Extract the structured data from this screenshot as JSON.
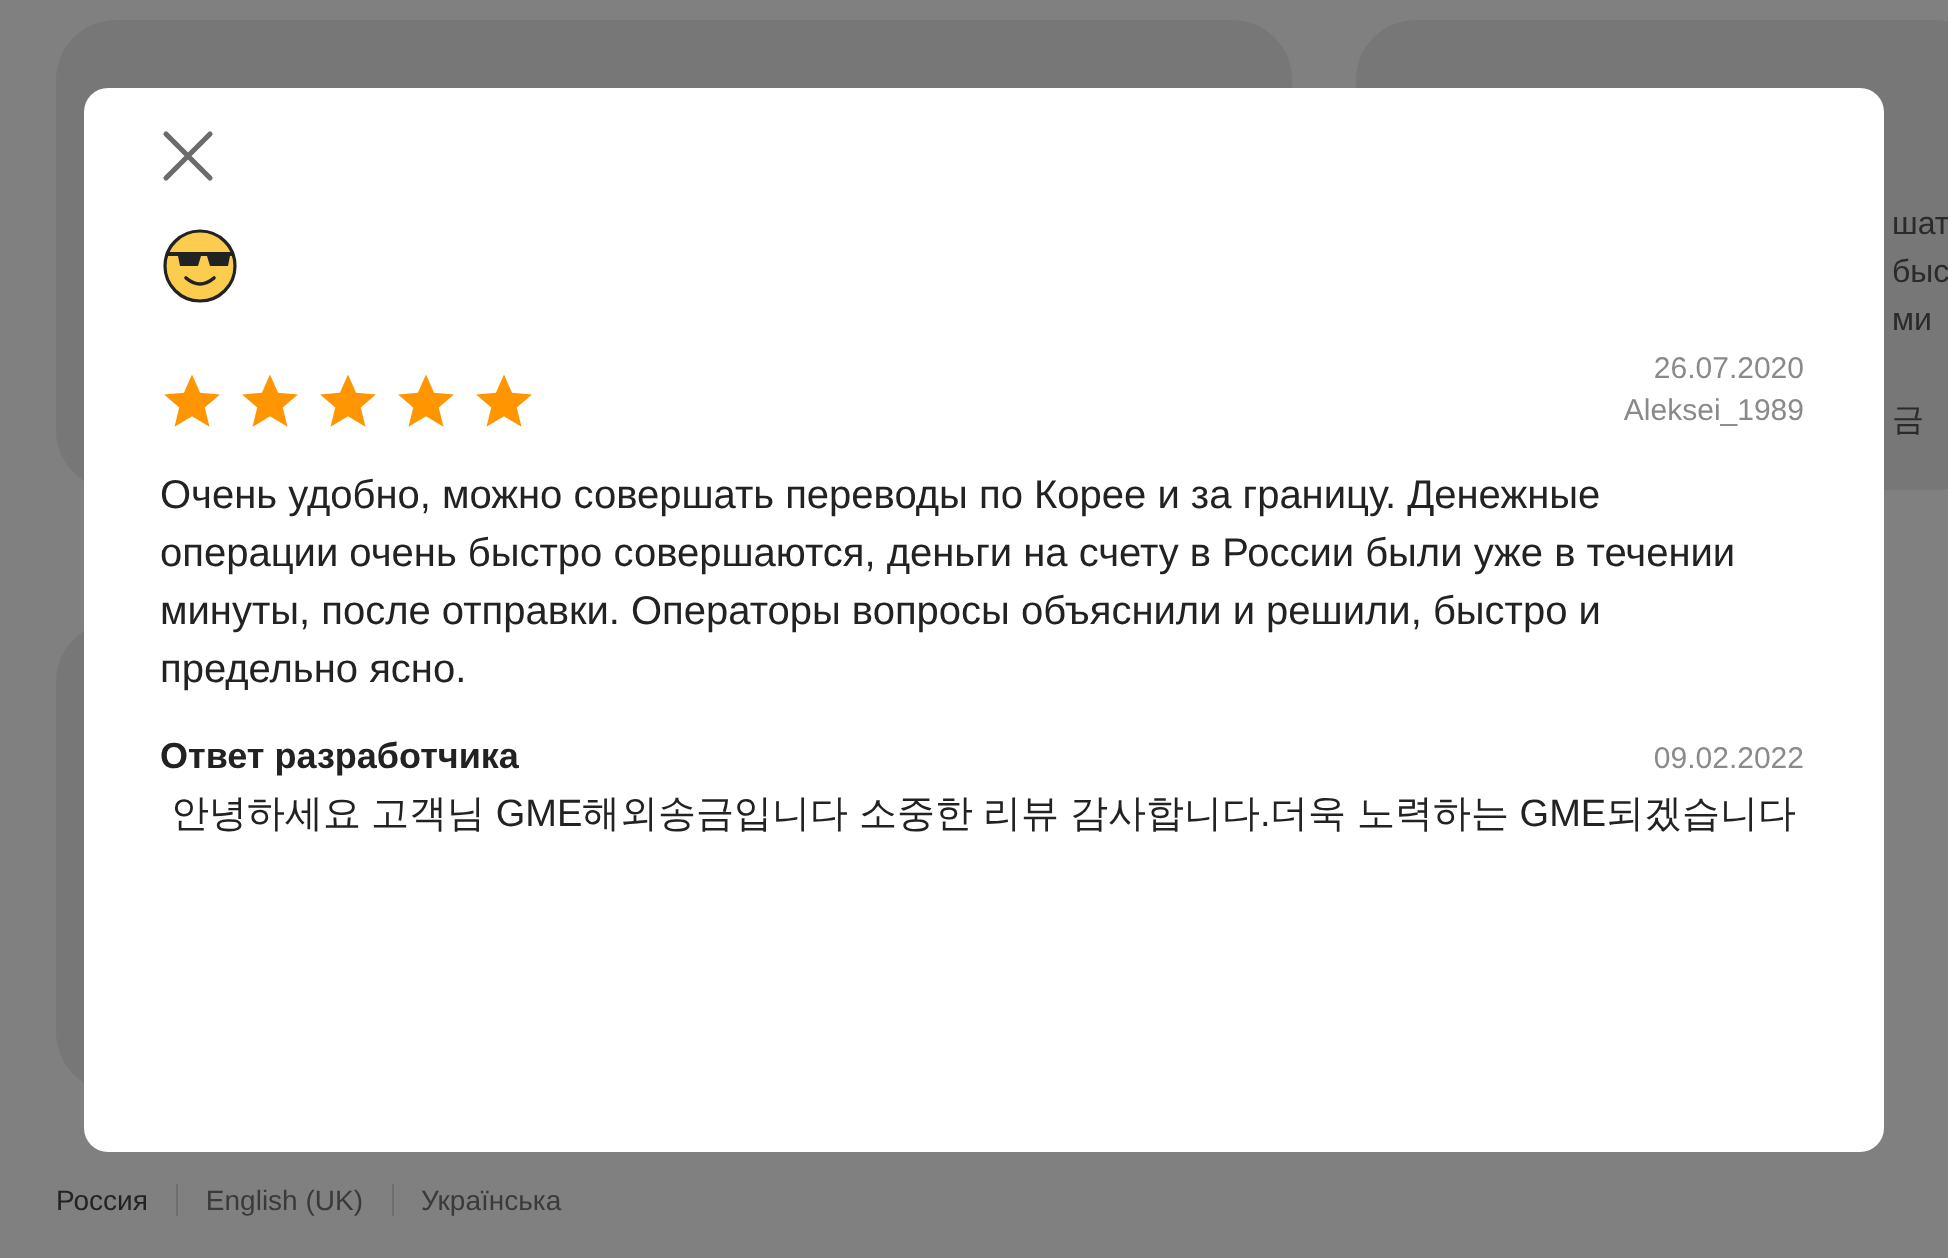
{
  "right_card": {
    "fragments": [
      "шат",
      "быс",
      "ми",
      "금"
    ]
  },
  "footer": {
    "languages": [
      {
        "label": "Россия",
        "selected": true
      },
      {
        "label": "English (UK)",
        "selected": false
      },
      {
        "label": "Українська",
        "selected": false
      }
    ]
  },
  "review_dialog": {
    "stars": 5,
    "date": "26.07.2020",
    "author": "Aleksei_1989",
    "text": "Очень удобно, можно совершать переводы по Корее и за границу. Денежные операции очень быстро совершаются,  деньги на счету в России были уже в течении минуты, после отправки. Операторы вопросы объяснили и решили, быстро и предельно ясно.",
    "response": {
      "title": "Ответ разработчика",
      "date": "09.02.2022",
      "text": " 안녕하세요 고객님 GME해외송금입니다 소중한 리뷰 감사합니다.더욱 노력하는 GME되겠습니다"
    }
  }
}
